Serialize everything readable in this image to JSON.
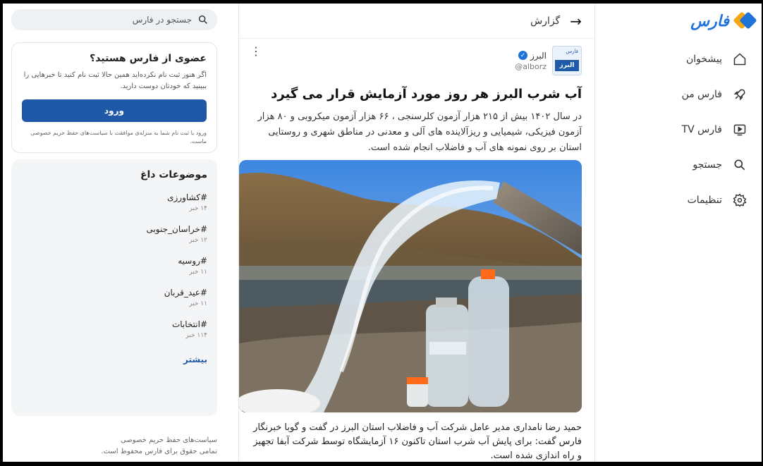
{
  "nav": {
    "logo_text": "فارس",
    "items": [
      {
        "label": "پیشخوان",
        "icon": "home-icon"
      },
      {
        "label": "فارس من",
        "icon": "rocket-icon"
      },
      {
        "label": "فارس TV",
        "icon": "tv-icon"
      },
      {
        "label": "جستجو",
        "icon": "search-icon"
      },
      {
        "label": "تنظیمات",
        "icon": "gear-icon"
      }
    ]
  },
  "article": {
    "header_title": "گزارش",
    "author_name": "البرز",
    "author_handle": "@alborz",
    "avatar_text": "البرز",
    "avatar_mini": "فارس",
    "title": "آب شرب البرز هر روز مورد آزمایش قرار می گیرد",
    "lead": "در سال ۱۴۰۲ بیش از ۲۱۵ هزار آزمون کلرسنجی ، ۶۶ هزار آزمون میکروبی و ۸۰ هزار آزمون فیزیکی، شیمیایی و ریزآلاینده های آلی و معدنی در مناطق شهری و روستایی استان بر روی نمونه های آب و فاضلاب انجام شده است.",
    "body": "حمید رضا نامداری مدیر عامل شرکت آب  و فاضلاب استان البرز در گفت و گوبا خبرنگار فارس گفت: برای پایش آب شرب استان تاکنون ۱۶ آزمایشگاه توسط شرکت آبفا تجهیز و راه اندازی شده است."
  },
  "sidebar": {
    "search_placeholder": "جستجو در فارس",
    "member": {
      "title": "عضوی از فارس هستید؟",
      "desc": "اگر هنوز ثبت نام نکرده‌اید همین حالا ثبت نام کنید تا خبرهایی را ببینید که خودتان دوست دارید.",
      "login_label": "ورود",
      "note": "ورود یا ثبت نام شما به منزله‌ی موافقت با سیاست‌های حفظ حریم خصوصی ماست."
    },
    "topics": {
      "title": "موضوعات داغ",
      "items": [
        {
          "tag": "#کشاورزی",
          "count": "۱۴ خبر"
        },
        {
          "tag": "#خراسان_جنوبی",
          "count": "۱۲ خبر"
        },
        {
          "tag": "#روسیه",
          "count": "۱۱ خبر"
        },
        {
          "tag": "#عید_قربان",
          "count": "۱۱ خبر"
        },
        {
          "tag": "#انتخابات",
          "count": "۱۱۴ خبر"
        }
      ],
      "more_label": "بیشتر"
    },
    "footer": {
      "privacy": "سیاست‌های حفظ حریم خصوصی",
      "copyright": "تمامی حقوق برای فارس محفوظ است."
    }
  }
}
